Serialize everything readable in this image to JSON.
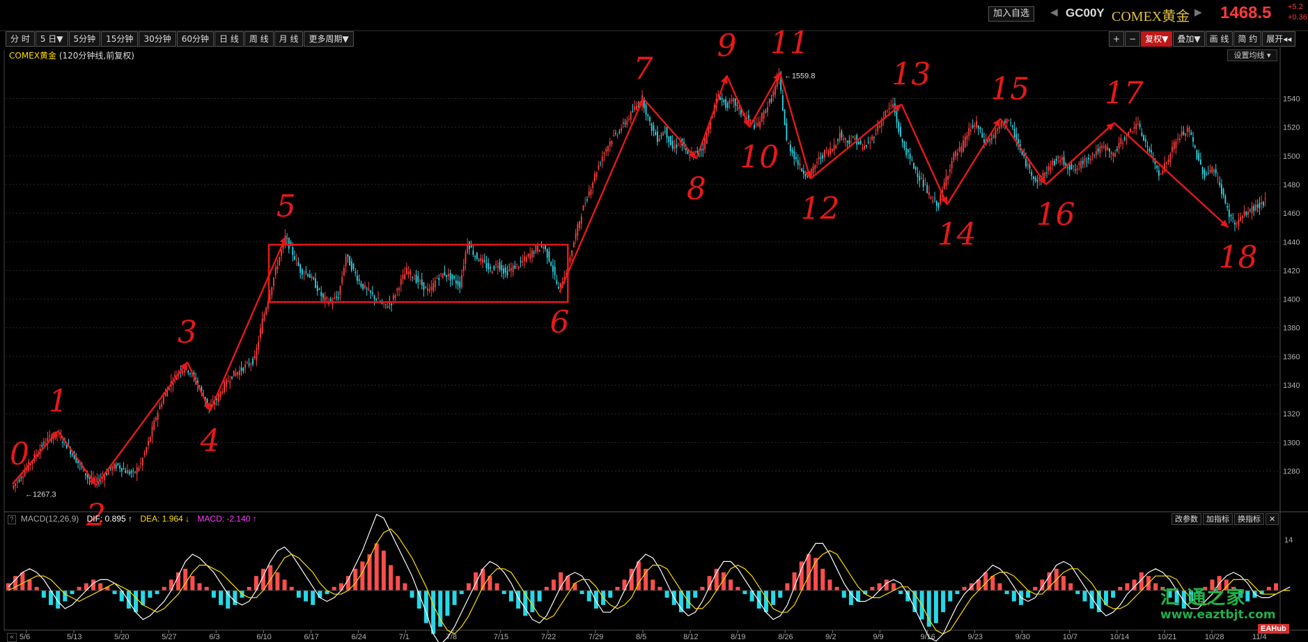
{
  "header": {
    "add_watchlist": "加入自选",
    "prev_arrow": "◀",
    "next_arrow": "▶",
    "symbol": "GC00Y",
    "name": "COMEX黄金",
    "price": "1468.5",
    "change": "+5.2",
    "change_pct": "+0.36"
  },
  "period_tabs": [
    "分 时",
    "5 日▼",
    "5分钟",
    "15分钟",
    "30分钟",
    "60分钟",
    "日 线",
    "周 线",
    "月 线",
    "更多周期▼"
  ],
  "right_tools": [
    {
      "label": "+",
      "active": false
    },
    {
      "label": "−",
      "active": false
    },
    {
      "label": "复权▼",
      "active": true
    },
    {
      "label": "叠加▼",
      "active": false
    },
    {
      "label": "画 线",
      "active": false
    },
    {
      "label": "简 约",
      "active": false
    },
    {
      "label": "展开◂◂",
      "active": false
    }
  ],
  "chart_title": {
    "name": "COMEX黄金",
    "info": "(120分钟线,前复权)"
  },
  "set_ma_label": "设置均线 ▾",
  "macd_legend": {
    "q": "?",
    "name": "MACD(12,26,9)",
    "dif": "DIF: 0.895 ↑",
    "dea": "DEA: 1.964 ↓",
    "macd": "MACD: -2.140 ↑"
  },
  "macd_tools": [
    "改参数",
    "加指标",
    "换指标",
    "✕"
  ],
  "watermark": {
    "name": "汇 通之家",
    "url": "www.eaztbjt.com",
    "logo": "EAHub"
  },
  "colors": {
    "up": "#ff4040",
    "down": "#31d6e6",
    "macd_pos": "#ff4d4d",
    "macd_neg": "#25d8e8",
    "annotation": "#e81818",
    "dif": "#ffffff",
    "dea": "#ffde00"
  },
  "chart_data": [
    {
      "type": "line",
      "title": "COMEX黄金 (120分钟线,前复权)",
      "y_ticks": [
        1280,
        1300,
        1320,
        1340,
        1360,
        1380,
        1400,
        1420,
        1440,
        1460,
        1480,
        1500,
        1520,
        1540
      ],
      "ylim": [
        1255,
        1565
      ],
      "x_ticks": [
        "5/6",
        "5/13",
        "5/20",
        "5/27",
        "6/3",
        "6/10",
        "6/17",
        "6/24",
        "7/1",
        "7/8",
        "7/15",
        "7/22",
        "7/29",
        "8/5",
        "8/12",
        "8/19",
        "8/26",
        "9/2",
        "9/9",
        "9/16",
        "9/23",
        "9/30",
        "10/7",
        "10/14",
        "10/21",
        "10/28",
        "11/4"
      ],
      "marked_low": "1267.3",
      "marked_high": "1559.8",
      "wave_points": [
        {
          "label": "0",
          "price": 1271
        },
        {
          "label": "1",
          "price": 1308
        },
        {
          "label": "2",
          "price": 1270
        },
        {
          "label": "3",
          "price": 1356
        },
        {
          "label": "4",
          "price": 1322
        },
        {
          "label": "5",
          "price": 1444
        },
        {
          "label": "6",
          "price": 1405
        },
        {
          "label": "7",
          "price": 1540
        },
        {
          "label": "8",
          "price": 1498
        },
        {
          "label": "9",
          "price": 1556
        },
        {
          "label": "10",
          "price": 1520
        },
        {
          "label": "11",
          "price": 1558
        },
        {
          "label": "12",
          "price": 1484
        },
        {
          "label": "13",
          "price": 1536
        },
        {
          "label": "14",
          "price": 1466
        },
        {
          "label": "15",
          "price": 1526
        },
        {
          "label": "16",
          "price": 1480
        },
        {
          "label": "17",
          "price": 1523
        },
        {
          "label": "18",
          "price": 1450
        }
      ],
      "range_box": {
        "top": 1438,
        "bottom": 1398
      },
      "price_path": [
        1268,
        1275,
        1282,
        1290,
        1298,
        1303,
        1306,
        1300,
        1292,
        1284,
        1276,
        1272,
        1276,
        1282,
        1284,
        1280,
        1278,
        1285,
        1300,
        1318,
        1332,
        1342,
        1350,
        1352,
        1345,
        1335,
        1324,
        1330,
        1340,
        1347,
        1350,
        1354,
        1358,
        1385,
        1405,
        1425,
        1443,
        1432,
        1420,
        1418,
        1410,
        1400,
        1398,
        1402,
        1430,
        1420,
        1410,
        1405,
        1400,
        1395,
        1398,
        1410,
        1420,
        1415,
        1410,
        1405,
        1415,
        1418,
        1414,
        1410,
        1440,
        1430,
        1426,
        1420,
        1425,
        1418,
        1422,
        1425,
        1430,
        1435,
        1437,
        1425,
        1406,
        1420,
        1440,
        1460,
        1475,
        1490,
        1503,
        1512,
        1518,
        1525,
        1533,
        1540,
        1522,
        1512,
        1518,
        1505,
        1510,
        1500,
        1502,
        1506,
        1525,
        1543,
        1535,
        1538,
        1530,
        1525,
        1520,
        1530,
        1540,
        1556,
        1510,
        1500,
        1490,
        1486,
        1496,
        1502,
        1505,
        1515,
        1510,
        1512,
        1505,
        1510,
        1520,
        1530,
        1536,
        1512,
        1500,
        1490,
        1480,
        1470,
        1466,
        1485,
        1500,
        1505,
        1518,
        1522,
        1510,
        1512,
        1520,
        1526,
        1515,
        1500,
        1490,
        1482,
        1488,
        1495,
        1498,
        1493,
        1490,
        1496,
        1500,
        1504,
        1506,
        1500,
        1510,
        1515,
        1523,
        1512,
        1500,
        1488,
        1495,
        1508,
        1515,
        1518,
        1500,
        1486,
        1492,
        1480,
        1462,
        1452,
        1458,
        1462,
        1465,
        1468
      ]
    },
    {
      "type": "bar",
      "title": "MACD(12,26,9)",
      "series_names": [
        "DIF",
        "DEA",
        "MACD"
      ],
      "y_ticks": [
        14
      ],
      "last_values": {
        "DIF": 0.895,
        "DEA": 1.964,
        "MACD": -2.14
      },
      "histogram": [
        2,
        4,
        5,
        3,
        1,
        -2,
        -4,
        -5,
        -3,
        -1,
        1,
        2,
        3,
        2,
        1,
        -1,
        -3,
        -5,
        -6,
        -4,
        -2,
        -1,
        1,
        3,
        5,
        6,
        4,
        2,
        1,
        -2,
        -4,
        -5,
        -4,
        -2,
        1,
        4,
        6,
        7,
        5,
        3,
        1,
        -2,
        -3,
        -4,
        -2,
        -1,
        1,
        2,
        4,
        6,
        8,
        10,
        13,
        11,
        7,
        4,
        2,
        -2,
        -5,
        -9,
        -12,
        -10,
        -7,
        -4,
        -1,
        2,
        5,
        6,
        4,
        2,
        -1,
        -3,
        -5,
        -7,
        -6,
        -3,
        1,
        3,
        5,
        4,
        2,
        -1,
        -3,
        -5,
        -4,
        -2,
        1,
        3,
        6,
        8,
        6,
        3,
        1,
        -2,
        -4,
        -6,
        -5,
        -2,
        1,
        4,
        6,
        5,
        3,
        1,
        -1,
        -3,
        -5,
        -6,
        -4,
        -2,
        2,
        5,
        8,
        10,
        9,
        6,
        3,
        1,
        -2,
        -4,
        -3,
        -1,
        1,
        2,
        3,
        2,
        -1,
        -3,
        -6,
        -8,
        -10,
        -9,
        -6,
        -3,
        -1,
        1,
        2,
        3,
        5,
        4,
        2,
        -1,
        -3,
        -4,
        -2,
        1,
        3,
        5,
        6,
        4,
        2,
        -1,
        -3,
        -5,
        -6,
        -4,
        -2,
        1,
        2,
        3,
        5,
        4,
        2,
        1,
        -2,
        -4,
        -5,
        -3,
        -1,
        1,
        3,
        4,
        3,
        1,
        -2,
        -3,
        -2,
        -1,
        1,
        2
      ],
      "dif": [
        1,
        3,
        5,
        6,
        5,
        3,
        0,
        -3,
        -5,
        -4,
        -2,
        0,
        2,
        3,
        3,
        2,
        0,
        -3,
        -6,
        -8,
        -7,
        -5,
        -3,
        0,
        4,
        8,
        10,
        9,
        7,
        5,
        2,
        -1,
        -3,
        -4,
        -3,
        0,
        4,
        8,
        11,
        12,
        10,
        7,
        4,
        1,
        -2,
        -3,
        -2,
        0,
        3,
        7,
        11,
        16,
        21,
        20,
        16,
        12,
        8,
        4,
        -1,
        -6,
        -12,
        -15,
        -13,
        -10,
        -6,
        -2,
        2,
        6,
        8,
        7,
        5,
        2,
        -2,
        -5,
        -8,
        -9,
        -7,
        -3,
        1,
        4,
        5,
        4,
        1,
        -3,
        -6,
        -6,
        -4,
        0,
        4,
        8,
        10,
        9,
        6,
        2,
        -2,
        -5,
        -7,
        -6,
        -3,
        1,
        5,
        8,
        8,
        6,
        3,
        0,
        -3,
        -6,
        -8,
        -7,
        -4,
        1,
        6,
        10,
        13,
        13,
        10,
        6,
        2,
        -1,
        -3,
        -3,
        -2,
        0,
        2,
        3,
        2,
        -1,
        -5,
        -9,
        -13,
        -14,
        -12,
        -8,
        -4,
        -1,
        1,
        3,
        5,
        7,
        6,
        4,
        1,
        -2,
        -3,
        -2,
        1,
        4,
        7,
        8,
        7,
        4,
        1,
        -2,
        -5,
        -7,
        -6,
        -4,
        -1,
        1,
        3,
        5,
        6,
        5,
        3,
        0,
        -3,
        -5,
        -5,
        -3,
        -1,
        2,
        4,
        5,
        4,
        2,
        -1,
        -2,
        -2,
        -1,
        0,
        1
      ],
      "dea": [
        0,
        1,
        2,
        3,
        4,
        4,
        3,
        1,
        -1,
        -2,
        -3,
        -2,
        -1,
        0,
        1,
        2,
        1,
        0,
        -2,
        -4,
        -5,
        -6,
        -5,
        -3,
        -1,
        2,
        5,
        7,
        7,
        6,
        5,
        3,
        1,
        -1,
        -2,
        -2,
        0,
        3,
        6,
        9,
        10,
        9,
        7,
        5,
        2,
        0,
        -1,
        -1,
        0,
        2,
        5,
        9,
        13,
        16,
        17,
        15,
        12,
        9,
        5,
        1,
        -4,
        -8,
        -11,
        -12,
        -10,
        -7,
        -3,
        1,
        4,
        6,
        6,
        5,
        2,
        -1,
        -4,
        -7,
        -8,
        -7,
        -4,
        -1,
        2,
        3,
        3,
        1,
        -2,
        -4,
        -5,
        -4,
        -2,
        2,
        5,
        7,
        7,
        6,
        3,
        0,
        -3,
        -5,
        -5,
        -3,
        0,
        3,
        6,
        7,
        6,
        4,
        1,
        -2,
        -5,
        -6,
        -6,
        -4,
        0,
        4,
        8,
        10,
        11,
        10,
        7,
        4,
        1,
        -1,
        -2,
        -2,
        -1,
        0,
        1,
        1,
        -1,
        -4,
        -8,
        -11,
        -12,
        -11,
        -8,
        -5,
        -2,
        0,
        2,
        4,
        5,
        5,
        4,
        2,
        0,
        -1,
        -1,
        1,
        3,
        5,
        6,
        6,
        4,
        2,
        -1,
        -4,
        -5,
        -5,
        -4,
        -2,
        0,
        2,
        4,
        4,
        4,
        3,
        0,
        -2,
        -4,
        -4,
        -3,
        -1,
        1,
        3,
        3,
        3,
        1,
        -1,
        -1,
        -1,
        0,
        0
      ]
    }
  ]
}
